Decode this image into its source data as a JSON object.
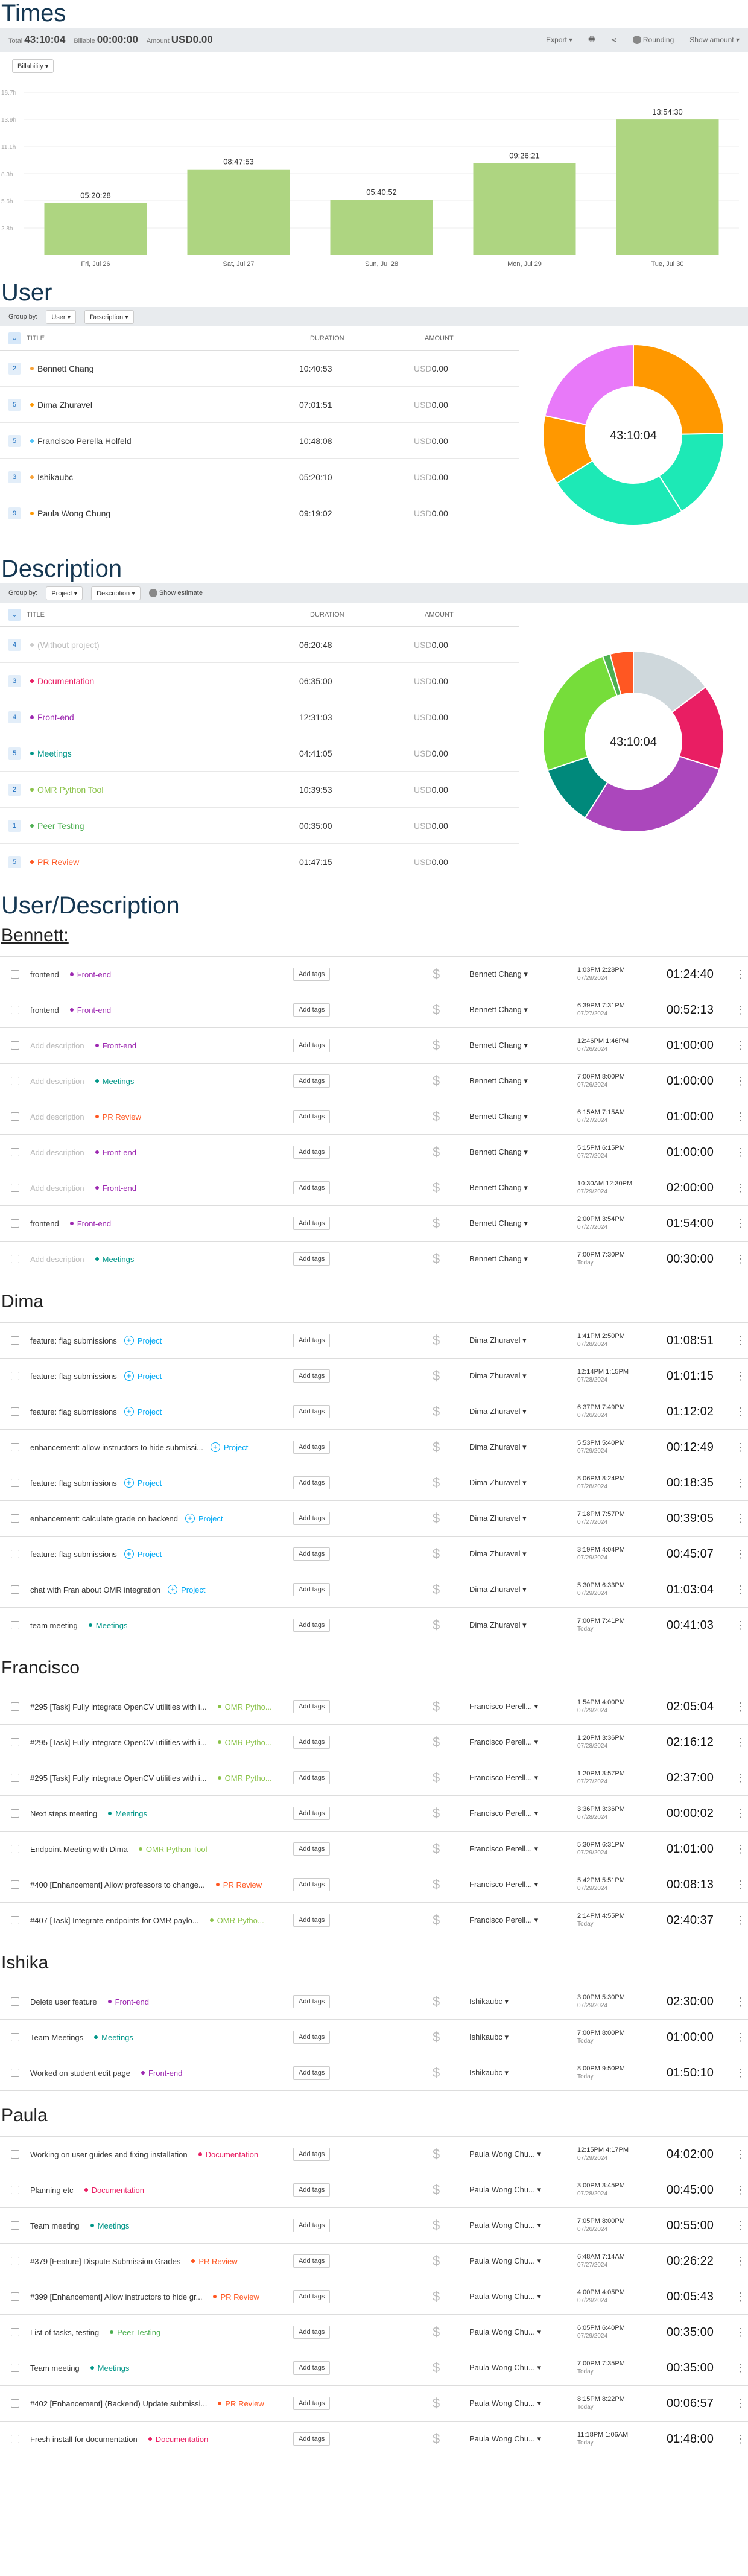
{
  "times": {
    "title": "Times",
    "total_label": "Total",
    "total": "43:10:04",
    "billable_label": "Billable",
    "billable": "00:00:00",
    "amount_label": "Amount",
    "amount": "USD0.00",
    "export": "Export",
    "rounding": "Rounding",
    "show_amount": "Show amount",
    "billability": "Billability",
    "chart_data": {
      "type": "bar",
      "categories": [
        "Fri, Jul 26",
        "Sat, Jul 27",
        "Sun, Jul 28",
        "Mon, Jul 29",
        "Tue, Jul 30"
      ],
      "values": [
        5.34,
        8.8,
        5.68,
        9.44,
        13.91
      ],
      "data_labels": [
        "05:20:28",
        "08:47:53",
        "05:40:52",
        "09:26:21",
        "13:54:30"
      ],
      "y_ticks": [
        "16.7h",
        "13.9h",
        "11.1h",
        "8.3h",
        "5.6h",
        "2.8h"
      ],
      "ylim": [
        0,
        16.7
      ]
    }
  },
  "user": {
    "title": "User",
    "group_by": "Group by:",
    "g1": "User",
    "g2": "Description",
    "col_title": "TITLE",
    "col_duration": "DURATION",
    "col_amount": "AMOUNT",
    "rows": [
      {
        "n": "2",
        "name": "Bennett Chang",
        "color": "#f7a136",
        "dur": "10:40:53",
        "amt": "USD0.00"
      },
      {
        "n": "5",
        "name": "Dima Zhuravel",
        "color": "#ff9800",
        "dur": "07:01:51",
        "amt": "USD0.00"
      },
      {
        "n": "5",
        "name": "Francisco Perella Holfeld",
        "color": "#4fc3f7",
        "dur": "10:48:08",
        "amt": "USD0.00"
      },
      {
        "n": "3",
        "name": "Ishikaubc",
        "color": "#f7a136",
        "dur": "05:20:10",
        "amt": "USD0.00"
      },
      {
        "n": "9",
        "name": "Paula Wong Chung",
        "color": "#ff9800",
        "dur": "09:19:02",
        "amt": "USD0.00"
      }
    ],
    "center": "43:10:04",
    "chart_data": {
      "type": "pie",
      "labels": [
        "Bennett Chang",
        "Dima Zhuravel",
        "Francisco Perella Holfeld",
        "Ishikaubc",
        "Paula Wong Chung"
      ],
      "values": [
        10.68,
        7.03,
        10.8,
        5.34,
        9.32
      ],
      "colors": [
        "#ff9800",
        "#1de9b6",
        "#1de9b6",
        "#ff9800",
        "#e879f9"
      ]
    }
  },
  "description": {
    "title": "Description",
    "group_by": "Group by:",
    "g1": "Project",
    "g2": "Description",
    "show_estimate": "Show estimate",
    "col_title": "TITLE",
    "col_duration": "DURATION",
    "col_amount": "AMOUNT",
    "rows": [
      {
        "n": "4",
        "name": "(Without project)",
        "color": "#ccc",
        "text": "#bbb",
        "dur": "06:20:48",
        "amt": "USD0.00"
      },
      {
        "n": "3",
        "name": "Documentation",
        "color": "#e91e63",
        "text": "#e91e63",
        "dur": "06:35:00",
        "amt": "USD0.00"
      },
      {
        "n": "4",
        "name": "Front-end",
        "color": "#9c27b0",
        "text": "#9c27b0",
        "dur": "12:31:03",
        "amt": "USD0.00"
      },
      {
        "n": "5",
        "name": "Meetings",
        "color": "#009688",
        "text": "#009688",
        "dur": "04:41:05",
        "amt": "USD0.00"
      },
      {
        "n": "2",
        "name": "OMR Python Tool",
        "color": "#8bc34a",
        "text": "#8bc34a",
        "dur": "10:39:53",
        "amt": "USD0.00"
      },
      {
        "n": "1",
        "name": "Peer Testing",
        "color": "#4caf50",
        "text": "#4caf50",
        "dur": "00:35:00",
        "amt": "USD0.00"
      },
      {
        "n": "5",
        "name": "PR Review",
        "color": "#ff5722",
        "text": "#ff5722",
        "dur": "01:47:15",
        "amt": "USD0.00"
      }
    ],
    "center": "43:10:04",
    "chart_data": {
      "type": "pie",
      "labels": [
        "(Without project)",
        "Documentation",
        "Front-end",
        "Meetings",
        "OMR Python Tool",
        "Peer Testing",
        "PR Review"
      ],
      "values": [
        6.35,
        6.58,
        12.52,
        4.68,
        10.66,
        0.58,
        1.79
      ],
      "colors": [
        "#cfd8dc",
        "#e91e63",
        "#ab47bc",
        "#00897b",
        "#76dd3a",
        "#4caf50",
        "#ff5722"
      ]
    }
  },
  "ud": {
    "title": "User/Description",
    "add_tags": "Add tags",
    "usd": "$",
    "more": "⋮",
    "groups": [
      {
        "name": "Bennett:",
        "underline": true,
        "entries": [
          {
            "desc": "frontend",
            "proj": "Front-end",
            "pc": "#9c27b0",
            "user": "Bennett Chang",
            "t": "1:03PM   2:28PM",
            "d": "07/29/2024",
            "dur": "01:24:40"
          },
          {
            "desc": "frontend",
            "proj": "Front-end",
            "pc": "#9c27b0",
            "user": "Bennett Chang",
            "t": "6:39PM   7:31PM",
            "d": "07/27/2024",
            "dur": "00:52:13"
          },
          {
            "desc": "Add description",
            "ph": true,
            "proj": "Front-end",
            "pc": "#9c27b0",
            "user": "Bennett Chang",
            "t": "12:46PM   1:46PM",
            "d": "07/26/2024",
            "dur": "01:00:00"
          },
          {
            "desc": "Add description",
            "ph": true,
            "proj": "Meetings",
            "pc": "#009688",
            "user": "Bennett Chang",
            "t": "7:00PM   8:00PM",
            "d": "07/26/2024",
            "dur": "01:00:00"
          },
          {
            "desc": "Add description",
            "ph": true,
            "proj": "PR Review",
            "pc": "#ff5722",
            "user": "Bennett Chang",
            "t": "6:15AM   7:15AM",
            "d": "07/27/2024",
            "dur": "01:00:00"
          },
          {
            "desc": "Add description",
            "ph": true,
            "proj": "Front-end",
            "pc": "#9c27b0",
            "user": "Bennett Chang",
            "t": "5:15PM   6:15PM",
            "d": "07/27/2024",
            "dur": "01:00:00"
          },
          {
            "desc": "Add description",
            "ph": true,
            "proj": "Front-end",
            "pc": "#9c27b0",
            "user": "Bennett Chang",
            "t": "10:30AM 12:30PM",
            "d": "07/29/2024",
            "dur": "02:00:00"
          },
          {
            "desc": "frontend",
            "proj": "Front-end",
            "pc": "#9c27b0",
            "user": "Bennett Chang",
            "t": "2:00PM   3:54PM",
            "d": "07/27/2024",
            "dur": "01:54:00"
          },
          {
            "desc": "Add description",
            "ph": true,
            "proj": "Meetings",
            "pc": "#009688",
            "user": "Bennett Chang",
            "t": "7:00PM   7:30PM",
            "d": "Today",
            "dur": "00:30:00"
          }
        ]
      },
      {
        "name": "Dima",
        "entries": [
          {
            "desc": "feature: flag submissions",
            "proj": "Project",
            "add": true,
            "pc": "#03a9f4",
            "user": "Dima Zhuravel",
            "t": "1:41PM   2:50PM",
            "d": "07/28/2024",
            "dur": "01:08:51"
          },
          {
            "desc": "feature: flag submissions",
            "proj": "Project",
            "add": true,
            "pc": "#03a9f4",
            "user": "Dima Zhuravel",
            "t": "12:14PM   1:15PM",
            "d": "07/28/2024",
            "dur": "01:01:15"
          },
          {
            "desc": "feature: flag submissions",
            "proj": "Project",
            "add": true,
            "pc": "#03a9f4",
            "user": "Dima Zhuravel",
            "t": "6:37PM   7:49PM",
            "d": "07/26/2024",
            "dur": "01:12:02"
          },
          {
            "desc": "enhancement: allow instructors to hide submissi...",
            "proj": "Project",
            "add": true,
            "pc": "#03a9f4",
            "user": "Dima Zhuravel",
            "t": "5:53PM   5:40PM",
            "d": "07/29/2024",
            "dur": "00:12:49"
          },
          {
            "desc": "feature: flag submissions",
            "proj": "Project",
            "add": true,
            "pc": "#03a9f4",
            "user": "Dima Zhuravel",
            "t": "8:06PM   8:24PM",
            "d": "07/28/2024",
            "dur": "00:18:35"
          },
          {
            "desc": "enhancement: calculate grade on backend",
            "proj": "Project",
            "add": true,
            "pc": "#03a9f4",
            "user": "Dima Zhuravel",
            "t": "7:18PM   7:57PM",
            "d": "07/27/2024",
            "dur": "00:39:05"
          },
          {
            "desc": "feature: flag submissions",
            "proj": "Project",
            "add": true,
            "pc": "#03a9f4",
            "user": "Dima Zhuravel",
            "t": "3:19PM   4:04PM",
            "d": "07/29/2024",
            "dur": "00:45:07"
          },
          {
            "desc": "chat with Fran about OMR integration",
            "proj": "Project",
            "add": true,
            "pc": "#03a9f4",
            "user": "Dima Zhuravel",
            "t": "5:30PM   6:33PM",
            "d": "07/29/2024",
            "dur": "01:03:04"
          },
          {
            "desc": "team meeting",
            "proj": "Meetings",
            "pc": "#009688",
            "user": "Dima Zhuravel",
            "t": "7:00PM   7:41PM",
            "d": "Today",
            "dur": "00:41:03"
          }
        ]
      },
      {
        "name": "Francisco",
        "entries": [
          {
            "desc": "#295 [Task] Fully integrate OpenCV utilities with i...",
            "proj": "OMR Pytho...",
            "pc": "#8bc34a",
            "user": "Francisco Perell...",
            "t": "1:54PM   4:00PM",
            "d": "07/29/2024",
            "dur": "02:05:04"
          },
          {
            "desc": "#295 [Task] Fully integrate OpenCV utilities with i...",
            "proj": "OMR Pytho...",
            "pc": "#8bc34a",
            "user": "Francisco Perell...",
            "t": "1:20PM   3:36PM",
            "d": "07/28/2024",
            "dur": "02:16:12"
          },
          {
            "desc": "#295 [Task] Fully integrate OpenCV utilities with i...",
            "proj": "OMR Pytho...",
            "pc": "#8bc34a",
            "user": "Francisco Perell...",
            "t": "1:20PM   3:57PM",
            "d": "07/27/2024",
            "dur": "02:37:00"
          },
          {
            "desc": "Next steps meeting",
            "proj": "Meetings",
            "pc": "#009688",
            "user": "Francisco Perell...",
            "t": "3:36PM   3:36PM",
            "d": "07/28/2024",
            "dur": "00:00:02"
          },
          {
            "desc": "Endpoint Meeting with Dima",
            "proj": "OMR Python Tool",
            "pc": "#8bc34a",
            "user": "Francisco Perell...",
            "t": "5:30PM   6:31PM",
            "d": "07/29/2024",
            "dur": "01:01:00"
          },
          {
            "desc": "#400 [Enhancement] Allow professors to change...",
            "proj": "PR Review",
            "pc": "#ff5722",
            "user": "Francisco Perell...",
            "t": "5:42PM   5:51PM",
            "d": "07/29/2024",
            "dur": "00:08:13"
          },
          {
            "desc": "#407 [Task] Integrate endpoints for OMR paylo...",
            "proj": "OMR Pytho...",
            "pc": "#8bc34a",
            "user": "Francisco Perell...",
            "t": "2:14PM   4:55PM",
            "d": "Today",
            "dur": "02:40:37"
          }
        ]
      },
      {
        "name": "Ishika",
        "entries": [
          {
            "desc": "Delete user feature",
            "proj": "Front-end",
            "pc": "#9c27b0",
            "user": "Ishikaubc",
            "t": "3:00PM   5:30PM",
            "d": "07/29/2024",
            "dur": "02:30:00"
          },
          {
            "desc": "Team Meetings",
            "proj": "Meetings",
            "pc": "#009688",
            "user": "Ishikaubc",
            "t": "7:00PM   8:00PM",
            "d": "Today",
            "dur": "01:00:00"
          },
          {
            "desc": "Worked on student edit page",
            "proj": "Front-end",
            "pc": "#9c27b0",
            "user": "Ishikaubc",
            "t": "8:00PM   9:50PM",
            "d": "Today",
            "dur": "01:50:10"
          }
        ]
      },
      {
        "name": "Paula",
        "entries": [
          {
            "desc": "Working on user guides and fixing installation",
            "proj": "Documentation",
            "pc": "#e91e63",
            "user": "Paula Wong Chu...",
            "t": "12:15PM   4:17PM",
            "d": "07/29/2024",
            "dur": "04:02:00"
          },
          {
            "desc": "Planning etc",
            "proj": "Documentation",
            "pc": "#e91e63",
            "user": "Paula Wong Chu...",
            "t": "3:00PM   3:45PM",
            "d": "07/28/2024",
            "dur": "00:45:00"
          },
          {
            "desc": "Team meeting",
            "proj": "Meetings",
            "pc": "#009688",
            "user": "Paula Wong Chu...",
            "t": "7:05PM   8:00PM",
            "d": "07/26/2024",
            "dur": "00:55:00"
          },
          {
            "desc": "#379 [Feature] Dispute Submission Grades",
            "proj": "PR Review",
            "pc": "#ff5722",
            "user": "Paula Wong Chu...",
            "t": "6:48AM   7:14AM",
            "d": "07/27/2024",
            "dur": "00:26:22"
          },
          {
            "desc": "#399 [Enhancement] Allow instructors to hide gr...",
            "proj": "PR Review",
            "pc": "#ff5722",
            "user": "Paula Wong Chu...",
            "t": "4:00PM   4:05PM",
            "d": "07/29/2024",
            "dur": "00:05:43"
          },
          {
            "desc": "List of tasks, testing",
            "proj": "Peer Testing",
            "pc": "#4caf50",
            "user": "Paula Wong Chu...",
            "t": "6:05PM   6:40PM",
            "d": "07/29/2024",
            "dur": "00:35:00"
          },
          {
            "desc": "Team meeting",
            "proj": "Meetings",
            "pc": "#009688",
            "user": "Paula Wong Chu...",
            "t": "7:00PM   7:35PM",
            "d": "Today",
            "dur": "00:35:00"
          },
          {
            "desc": "#402 [Enhancement] (Backend) Update submissi...",
            "proj": "PR Review",
            "pc": "#ff5722",
            "user": "Paula Wong Chu...",
            "t": "8:15PM   8:22PM",
            "d": "Today",
            "dur": "00:06:57"
          },
          {
            "desc": "Fresh install for documentation",
            "proj": "Documentation",
            "pc": "#e91e63",
            "user": "Paula Wong Chu...",
            "t": "11:18PM   1:06AM",
            "d": "Today",
            "dur": "01:48:00"
          }
        ]
      }
    ]
  }
}
